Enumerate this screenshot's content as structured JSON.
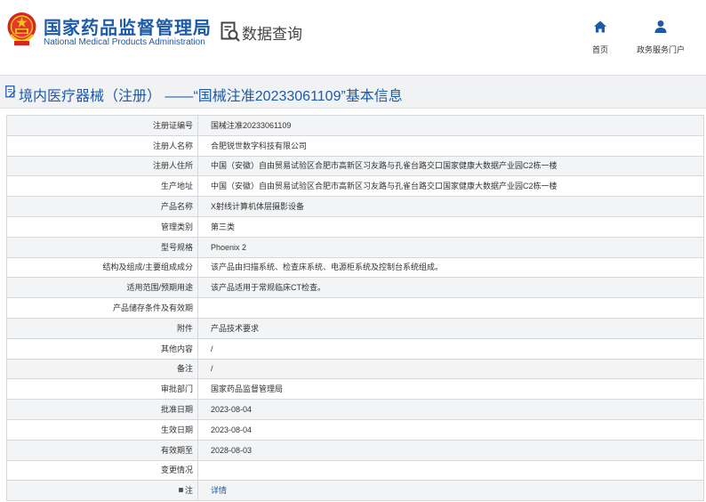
{
  "header": {
    "org_name_cn": "国家药品监督管理局",
    "org_name_en": "National Medical Products Administration",
    "data_query_label": "数据查询",
    "nav": [
      {
        "label": "首页",
        "icon": "home-icon"
      },
      {
        "label": "政务服务门户",
        "icon": "user-icon"
      }
    ]
  },
  "page": {
    "title": "境内医疗器械（注册） ——“国械注准20233061109”基本信息"
  },
  "record": {
    "rows": [
      {
        "key": "注册证编号",
        "value": "国械注准20233061109"
      },
      {
        "key": "注册人名称",
        "value": "合肥锐世数字科技有限公司"
      },
      {
        "key": "注册人住所",
        "value": "中国（安徽）自由贸易试验区合肥市高新区习友路与孔雀台路交口国家健康大数据产业园C2栋一楼"
      },
      {
        "key": "生产地址",
        "value": "中国（安徽）自由贸易试验区合肥市高新区习友路与孔雀台路交口国家健康大数据产业园C2栋一楼"
      },
      {
        "key": "产品名称",
        "value": "X射线计算机体层摄影设备"
      },
      {
        "key": "管理类别",
        "value": "第三类"
      },
      {
        "key": "型号规格",
        "value": "Phoenix 2"
      },
      {
        "key": "结构及组成/主要组成成分",
        "value": "该产品由扫描系统、检查床系统、电源柜系统及控制台系统组成。"
      },
      {
        "key": "适用范围/预期用途",
        "value": "该产品适用于常规临床CT检查。"
      },
      {
        "key": "产品储存条件及有效期",
        "value": ""
      },
      {
        "key": "附件",
        "value": "产品技术要求"
      },
      {
        "key": "其他内容",
        "value": "/"
      },
      {
        "key": "备注",
        "value": "/"
      },
      {
        "key": "审批部门",
        "value": "国家药品监督管理局"
      },
      {
        "key": "批准日期",
        "value": "2023-08-04"
      },
      {
        "key": "生效日期",
        "value": "2023-08-04"
      },
      {
        "key": "有效期至",
        "value": "2028-08-03"
      },
      {
        "key": "变更情况",
        "value": ""
      }
    ],
    "note": {
      "key": "注",
      "link_label": "详情"
    }
  },
  "colors": {
    "brand_blue": "#1d5aa8",
    "row_stripe": "#f3f4f6",
    "border": "#d5d8dd"
  }
}
